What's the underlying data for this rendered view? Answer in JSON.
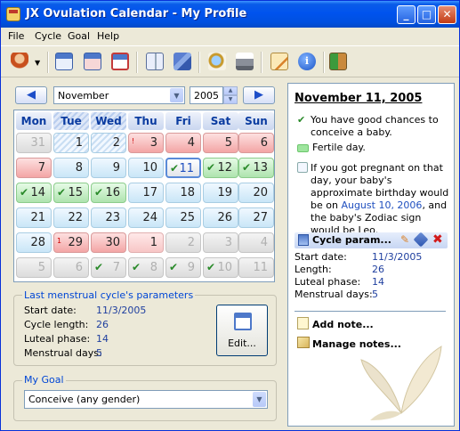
{
  "window": {
    "title": "JX Ovulation Calendar - My Profile"
  },
  "menu": [
    "File",
    "Cycle",
    "Goal",
    "Help"
  ],
  "toolbar": {
    "icons": [
      "profile-icon",
      "calendar-icon",
      "calendar-view-icon",
      "calendar-red-icon",
      "notebook-icon",
      "books-icon",
      "search-doc-icon",
      "print-icon",
      "edit-doc-icon",
      "info-icon",
      "exit-icon"
    ]
  },
  "nav": {
    "month": "November",
    "year": "2005"
  },
  "calendar": {
    "weekdays": [
      "Mon",
      "Tue",
      "Wed",
      "Thu",
      "Fri",
      "Sat",
      "Sun"
    ],
    "weeks": [
      [
        {
          "d": "31",
          "s": "gray"
        },
        {
          "d": "1",
          "s": "hatchblue"
        },
        {
          "d": "2",
          "s": "hatchblue"
        },
        {
          "d": "3",
          "s": "red",
          "m": "!"
        },
        {
          "d": "4",
          "s": "red"
        },
        {
          "d": "5",
          "s": "red"
        },
        {
          "d": "6",
          "s": "red"
        }
      ],
      [
        {
          "d": "7",
          "s": "red"
        },
        {
          "d": "8",
          "s": "blue"
        },
        {
          "d": "9",
          "s": "blue"
        },
        {
          "d": "10",
          "s": "blue"
        },
        {
          "d": "11",
          "s": "today",
          "c": "✔"
        },
        {
          "d": "12",
          "s": "green",
          "c": "✔"
        },
        {
          "d": "13",
          "s": "green",
          "c": "✔"
        }
      ],
      [
        {
          "d": "14",
          "s": "green",
          "c": "✔"
        },
        {
          "d": "15",
          "s": "green",
          "c": "✔"
        },
        {
          "d": "16",
          "s": "green",
          "c": "✔"
        },
        {
          "d": "17",
          "s": "blue"
        },
        {
          "d": "18",
          "s": "blue"
        },
        {
          "d": "19",
          "s": "blue"
        },
        {
          "d": "20",
          "s": "blue"
        }
      ],
      [
        {
          "d": "21",
          "s": "blue"
        },
        {
          "d": "22",
          "s": "blue"
        },
        {
          "d": "23",
          "s": "blue"
        },
        {
          "d": "24",
          "s": "blue"
        },
        {
          "d": "25",
          "s": "blue"
        },
        {
          "d": "26",
          "s": "blue"
        },
        {
          "d": "27",
          "s": "blue"
        }
      ],
      [
        {
          "d": "28",
          "s": "blue"
        },
        {
          "d": "29",
          "s": "red",
          "m": "1"
        },
        {
          "d": "30",
          "s": "red"
        },
        {
          "d": "1",
          "s": "pink"
        },
        {
          "d": "2",
          "s": "gray"
        },
        {
          "d": "3",
          "s": "gray"
        },
        {
          "d": "4",
          "s": "gray"
        }
      ],
      [
        {
          "d": "5",
          "s": "gray"
        },
        {
          "d": "6",
          "s": "gray"
        },
        {
          "d": "7",
          "s": "gray",
          "c": "✔"
        },
        {
          "d": "8",
          "s": "gray",
          "c": "✔"
        },
        {
          "d": "9",
          "s": "gray",
          "c": "✔"
        },
        {
          "d": "10",
          "s": "gray",
          "c": "✔"
        },
        {
          "d": "11",
          "s": "gray"
        }
      ]
    ]
  },
  "cycle_params": {
    "title": "Last menstrual cycle's parameters",
    "rows": [
      {
        "label": "Start date:",
        "value": "11/3/2005"
      },
      {
        "label": "Cycle length:",
        "value": "26"
      },
      {
        "label": "Luteal phase:",
        "value": "14"
      },
      {
        "label": "Menstrual days:",
        "value": "5"
      }
    ],
    "edit_label": "Edit..."
  },
  "goal": {
    "title": "My Goal",
    "value": "Conceive (any gender)"
  },
  "info": {
    "date": "November 11, 2005",
    "line1": "You have good chances to conceive a baby.",
    "line2": "Fertile day.",
    "line3a": "If you got pregnant on that day, your baby's approximate birthday would be on",
    "line3link": "August 10, 2006",
    "line3b": ", and the baby's Zodiac sign would be Leo.",
    "param_header": "Cycle param...",
    "rows": [
      {
        "label": "Start date:",
        "value": "11/3/2005"
      },
      {
        "label": "Length:",
        "value": "26"
      },
      {
        "label": "Luteal phase:",
        "value": "14"
      },
      {
        "label": "Menstrual days:",
        "value": "5"
      }
    ],
    "add_note": "Add note...",
    "manage_notes": "Manage notes..."
  }
}
